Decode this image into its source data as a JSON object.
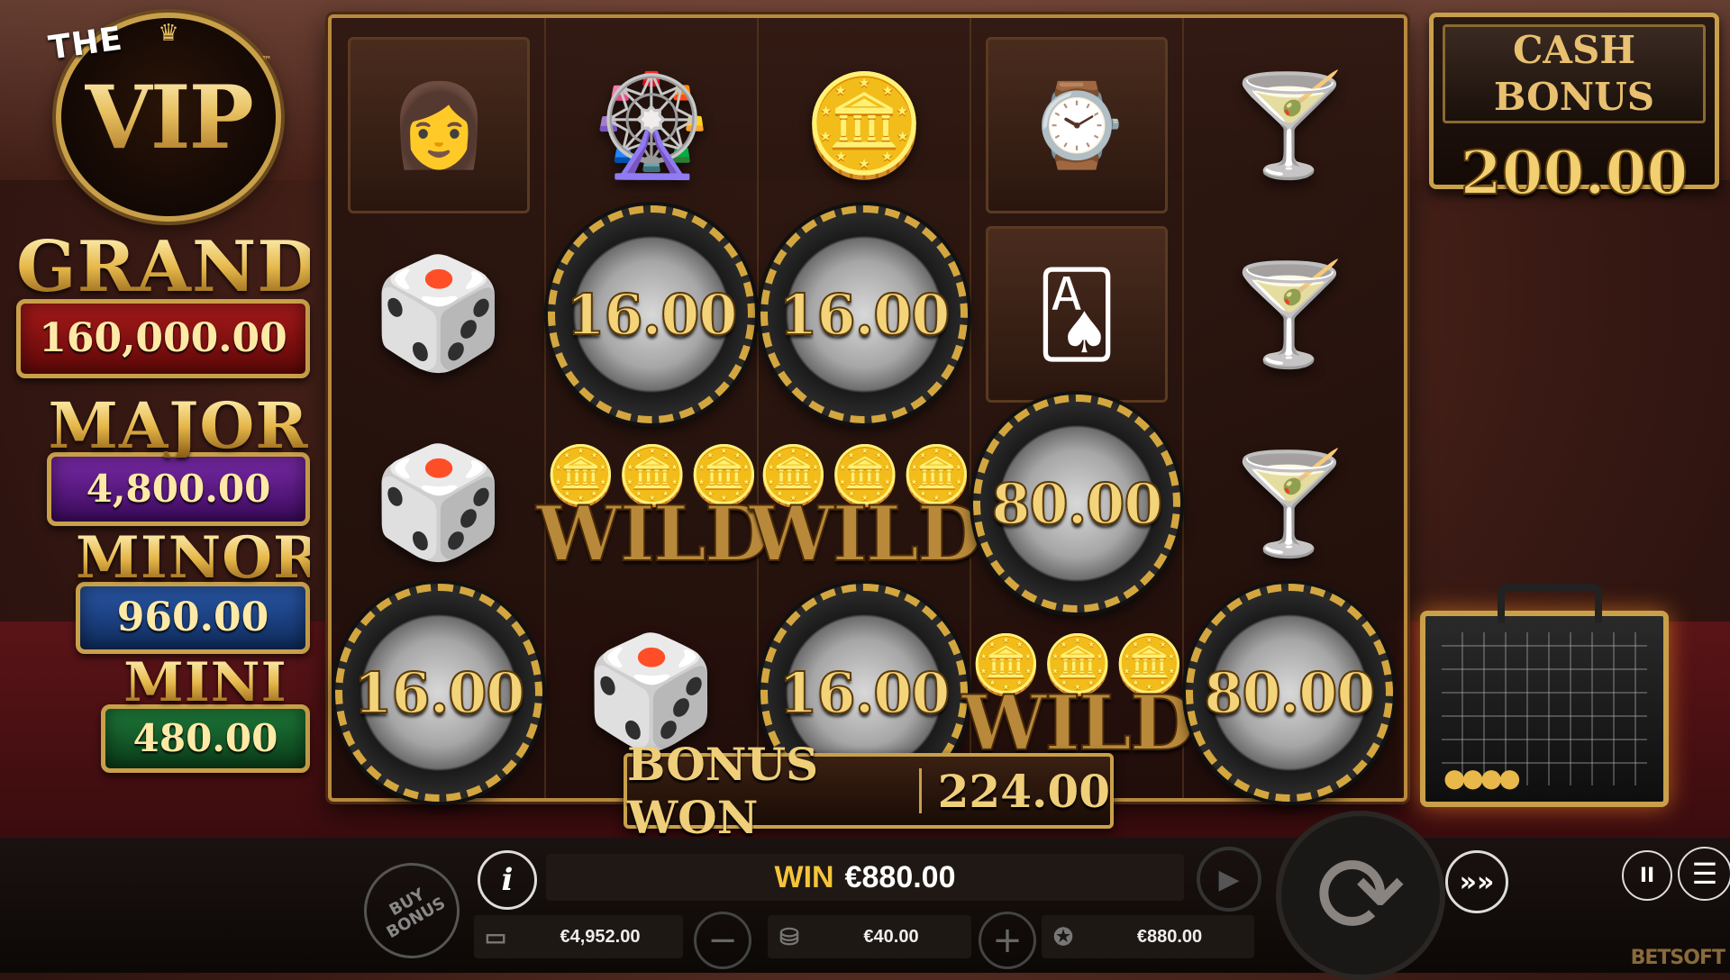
{
  "logo": {
    "the": "THE",
    "main": "VIP",
    "tm": "™",
    "crown": "♛"
  },
  "jackpots": {
    "grand": {
      "label": "GRAND",
      "value": "160,000.00",
      "color": "#a81a1a"
    },
    "major": {
      "label": "MAJOR",
      "value": "4,800.00",
      "color": "#7a2aa8"
    },
    "minor": {
      "label": "MINOR",
      "value": "960.00",
      "color": "#2a58a8"
    },
    "mini": {
      "label": "MINI",
      "value": "480.00",
      "color": "#1f7a3a"
    }
  },
  "cash_bonus": {
    "label": "CASH BONUS",
    "value": "200.00"
  },
  "reels": {
    "symbols": {
      "lady": "👩",
      "roulette": "🎡",
      "chips": "🪙",
      "watch": "⌚",
      "martini": "🍸",
      "dice": "🎲",
      "cards": "🂡"
    },
    "chips": {
      "r1c1": "16.00",
      "r1c2": "16.00",
      "r2c3": "80.00",
      "r3c0": "16.00",
      "r3c2": "16.00",
      "r3c4": "80.00"
    },
    "wild_label": "WILD",
    "coins": "🪙🪙🪙"
  },
  "bonus_won": {
    "label": "BONUS WON",
    "value": "224.00"
  },
  "briefcase": {
    "coins": "●●●●"
  },
  "controls": {
    "buy_bonus": "BUY BONUS",
    "info": "i",
    "win_label": "WIN",
    "win_value": "€880.00",
    "replay_icon": "▶",
    "spin_icon": "⟳",
    "turbo_icon": "»»",
    "pause_icon": "II",
    "menu_icon": "☰",
    "balance_icon": "▭",
    "balance": "€4,952.00",
    "minus": "−",
    "bet_icon": "⛁",
    "bet": "€40.00",
    "plus": "+",
    "win_icon": "✪",
    "win_total": "€880.00"
  },
  "brand": "BETSOFT"
}
